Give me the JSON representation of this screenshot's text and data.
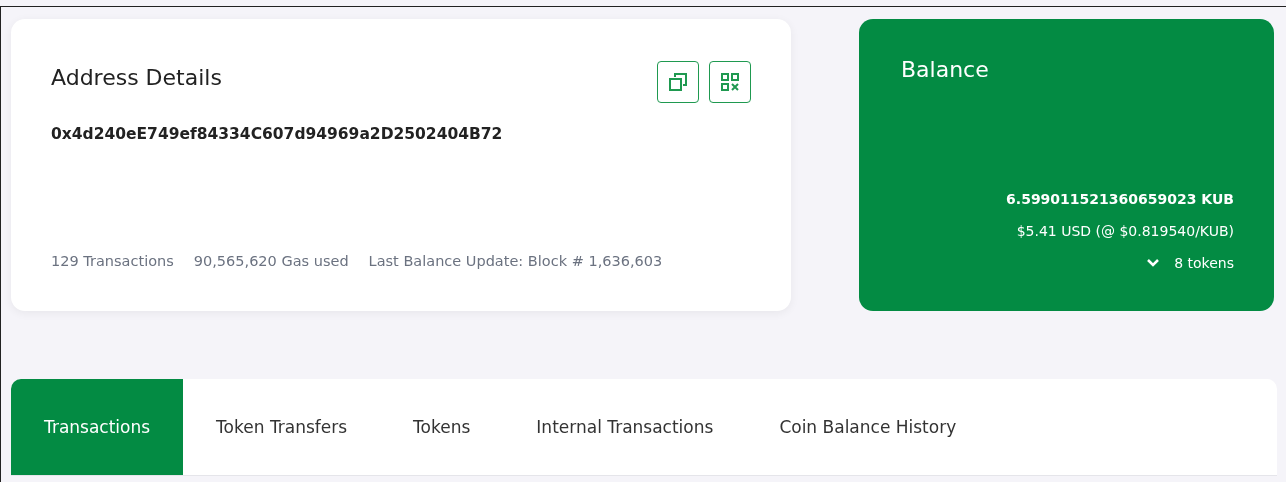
{
  "address_card": {
    "title": "Address Details",
    "address": "0x4d240eE749ef84334C607d94969a2D2502404B72",
    "stats": [
      "129 Transactions",
      "90,565,620 Gas used",
      "Last Balance Update: Block # 1,636,603"
    ]
  },
  "balance_card": {
    "title": "Balance",
    "amount": "6.599011521360659023 KUB",
    "usd": "$5.41 USD (@ $0.819540/KUB)",
    "tokens": "8 tokens",
    "expanded": false
  },
  "tabs": [
    {
      "label": "Transactions",
      "selected": true
    },
    {
      "label": "Token Transfers",
      "selected": false
    },
    {
      "label": "Tokens",
      "selected": false
    },
    {
      "label": "Internal Transactions",
      "selected": false
    },
    {
      "label": "Coin Balance History",
      "selected": false
    }
  ]
}
